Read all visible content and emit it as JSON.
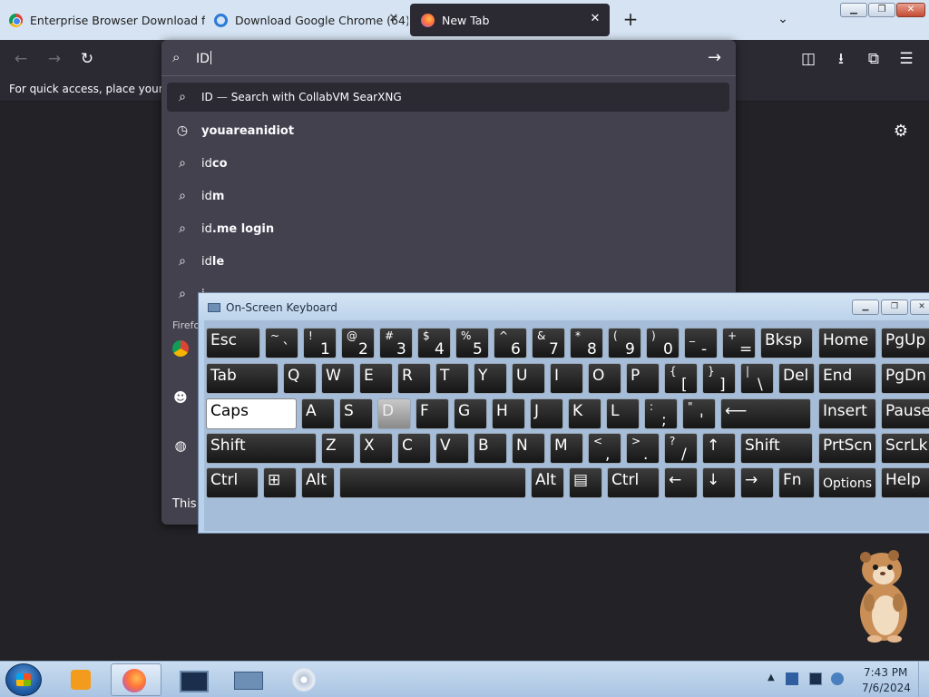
{
  "tabs": [
    {
      "title": "Enterprise Browser Download f",
      "favicon": "chrome-icon"
    },
    {
      "title": "Download Google Chrome (64)",
      "favicon": "edge-icon"
    },
    {
      "title": "New Tab",
      "favicon": "firefox-icon",
      "active": true
    }
  ],
  "tabstrip": {
    "new_tab": "+",
    "list_all": "⌄"
  },
  "window_controls": {
    "minimize": "▁",
    "maximize": "❐",
    "close": "✕"
  },
  "navbar": {
    "back": "←",
    "forward": "→",
    "reload": "↻",
    "pocket": "◫",
    "downloads": "⭳",
    "extensions": "⧉",
    "menu": "☰"
  },
  "bookmarks_toolbar": {
    "hint": "For quick access, place your boo"
  },
  "page": {
    "settings_icon": "⚙"
  },
  "urlbar": {
    "value": "ID",
    "search_icon": "⌕",
    "go_icon": "→",
    "suggestions": [
      {
        "icon": "search-icon",
        "glyph": "⌕",
        "prefix": "ID",
        "rest": "",
        "engine_sep": "—",
        "engine_text": "Search with CollabVM SearXNG"
      },
      {
        "icon": "history-icon",
        "glyph": "◷",
        "prefix": "",
        "rest": "youareanidiot"
      },
      {
        "icon": "search-icon",
        "glyph": "⌕",
        "prefix": "id",
        "rest": "co"
      },
      {
        "icon": "search-icon",
        "glyph": "⌕",
        "prefix": "id",
        "rest": "m"
      },
      {
        "icon": "search-icon",
        "glyph": "⌕",
        "prefix": "id",
        "rest": ".me login"
      },
      {
        "icon": "search-icon",
        "glyph": "⌕",
        "prefix": "id",
        "rest": "le"
      },
      {
        "icon": "search-icon",
        "glyph": "⌕",
        "prefix": "i",
        "rest": ""
      }
    ],
    "section_label": "Firefo",
    "quick_icons": {
      "smile": "☻",
      "globe": "◍"
    },
    "footer": "This"
  },
  "osk": {
    "title": "On-Screen Keyboard",
    "minimize": "▁",
    "maximize": "❐",
    "close": "✕",
    "rows": [
      [
        {
          "k": "esc",
          "label": "Esc"
        },
        {
          "k": "tilde",
          "shift": "~",
          "base": "`"
        },
        {
          "k": "1",
          "shift": "!",
          "base": "1"
        },
        {
          "k": "2",
          "shift": "@",
          "base": "2"
        },
        {
          "k": "3",
          "shift": "#",
          "base": "3"
        },
        {
          "k": "4",
          "shift": "$",
          "base": "4"
        },
        {
          "k": "5",
          "shift": "%",
          "base": "5"
        },
        {
          "k": "6",
          "shift": "^",
          "base": "6"
        },
        {
          "k": "7",
          "shift": "&",
          "base": "7"
        },
        {
          "k": "8",
          "shift": "*",
          "base": "8"
        },
        {
          "k": "9",
          "shift": "(",
          "base": "9"
        },
        {
          "k": "0",
          "shift": ")",
          "base": "0"
        },
        {
          "k": "minus",
          "shift": "_",
          "base": "-"
        },
        {
          "k": "equals",
          "shift": "+",
          "base": "="
        },
        {
          "k": "bksp",
          "label": "Bksp"
        },
        {
          "k": "home",
          "label": "Home"
        },
        {
          "k": "pgup",
          "label": "PgUp"
        }
      ],
      [
        {
          "k": "tab",
          "label": "Tab"
        },
        {
          "k": "q",
          "label": "Q"
        },
        {
          "k": "w",
          "label": "W"
        },
        {
          "k": "e",
          "label": "E"
        },
        {
          "k": "r",
          "label": "R"
        },
        {
          "k": "t",
          "label": "T"
        },
        {
          "k": "y",
          "label": "Y"
        },
        {
          "k": "u",
          "label": "U"
        },
        {
          "k": "i",
          "label": "I"
        },
        {
          "k": "o",
          "label": "O"
        },
        {
          "k": "p",
          "label": "P"
        },
        {
          "k": "lbracket",
          "shift": "{",
          "base": "["
        },
        {
          "k": "rbracket",
          "shift": "}",
          "base": "]"
        },
        {
          "k": "backslash",
          "shift": "|",
          "base": "\\"
        },
        {
          "k": "del",
          "label": "Del"
        },
        {
          "k": "end",
          "label": "End"
        },
        {
          "k": "pgdn",
          "label": "PgDn"
        }
      ],
      [
        {
          "k": "caps",
          "label": "Caps",
          "state": "on"
        },
        {
          "k": "a",
          "label": "A"
        },
        {
          "k": "s",
          "label": "S"
        },
        {
          "k": "d",
          "label": "D",
          "state": "pressed"
        },
        {
          "k": "f",
          "label": "F"
        },
        {
          "k": "g",
          "label": "G"
        },
        {
          "k": "h",
          "label": "H"
        },
        {
          "k": "j",
          "label": "J"
        },
        {
          "k": "k",
          "label": "K"
        },
        {
          "k": "l",
          "label": "L"
        },
        {
          "k": "semicolon",
          "shift": ":",
          "base": ";"
        },
        {
          "k": "quote",
          "shift": "\"",
          "base": "'"
        },
        {
          "k": "enter",
          "label": "⟵"
        },
        {
          "k": "insert",
          "label": "Insert"
        },
        {
          "k": "pause",
          "label": "Pause"
        }
      ],
      [
        {
          "k": "lshift",
          "label": "Shift"
        },
        {
          "k": "z",
          "label": "Z"
        },
        {
          "k": "x",
          "label": "X"
        },
        {
          "k": "c",
          "label": "C"
        },
        {
          "k": "v",
          "label": "V"
        },
        {
          "k": "b",
          "label": "B"
        },
        {
          "k": "n",
          "label": "N"
        },
        {
          "k": "m",
          "label": "M"
        },
        {
          "k": "comma",
          "shift": "<",
          "base": ","
        },
        {
          "k": "period",
          "shift": ">",
          "base": "."
        },
        {
          "k": "slash",
          "shift": "?",
          "base": "/"
        },
        {
          "k": "up",
          "label": "↑"
        },
        {
          "k": "rshift",
          "label": "Shift"
        },
        {
          "k": "prtscn",
          "label": "PrtScn"
        },
        {
          "k": "scrlk",
          "label": "ScrLk"
        }
      ],
      [
        {
          "k": "lctrl",
          "label": "Ctrl"
        },
        {
          "k": "win",
          "label": "⊞"
        },
        {
          "k": "lalt",
          "label": "Alt"
        },
        {
          "k": "space",
          "label": ""
        },
        {
          "k": "ralt",
          "label": "Alt"
        },
        {
          "k": "menu",
          "label": "▤"
        },
        {
          "k": "rctrl",
          "label": "Ctrl"
        },
        {
          "k": "left",
          "label": "←"
        },
        {
          "k": "down",
          "label": "↓"
        },
        {
          "k": "right",
          "label": "→"
        },
        {
          "k": "fn",
          "label": "Fn"
        },
        {
          "k": "options",
          "label": "Options",
          "small": true
        },
        {
          "k": "help",
          "label": "Help"
        }
      ]
    ]
  },
  "taskbar": {
    "apps": [
      "windows-media-player-icon",
      "firefox-icon",
      "remote-desktop-icon",
      "on-screen-keyboard-icon",
      "cd-drive-icon"
    ],
    "tray_arrow": "▲",
    "clock_time": "7:43 PM",
    "clock_date": "7/6/2024"
  }
}
